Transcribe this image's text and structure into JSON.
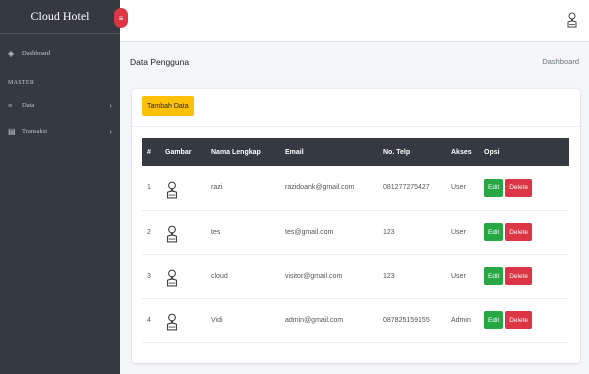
{
  "brand": "Cloud Hotel",
  "sidebar": {
    "dashboard": "Dashboard",
    "header": "MASTER",
    "items": [
      {
        "label": "Data",
        "icon": "list-icon"
      },
      {
        "label": "Transaksi",
        "icon": "table-icon"
      }
    ]
  },
  "content": {
    "title": "Data Pengguna",
    "breadcrumb": "Dashboard",
    "add_button": "Tambah Data"
  },
  "table": {
    "headers": [
      "#",
      "Gambar",
      "Nama Lengkap",
      "Email",
      "No. Telp",
      "Akses",
      "Opsi"
    ],
    "rows": [
      {
        "no": "1",
        "nama": "razi",
        "email": "razidoank@gmail.com",
        "telp": "081277275427",
        "akses": "User"
      },
      {
        "no": "2",
        "nama": "tes",
        "email": "tes@gmail.com",
        "telp": "123",
        "akses": "User"
      },
      {
        "no": "3",
        "nama": "cloud",
        "email": "visitor@gmail.com",
        "telp": "123",
        "akses": "User"
      },
      {
        "no": "4",
        "nama": "Vidi",
        "email": "admin@gmail.com",
        "telp": "087825159155",
        "akses": "Admin"
      }
    ],
    "edit_label": "Edit",
    "delete_label": "Delete"
  },
  "colors": {
    "sidebar": "#343a40",
    "add_button": "#ffc107",
    "edit_button": "#28a745",
    "delete_button": "#dc3545"
  }
}
